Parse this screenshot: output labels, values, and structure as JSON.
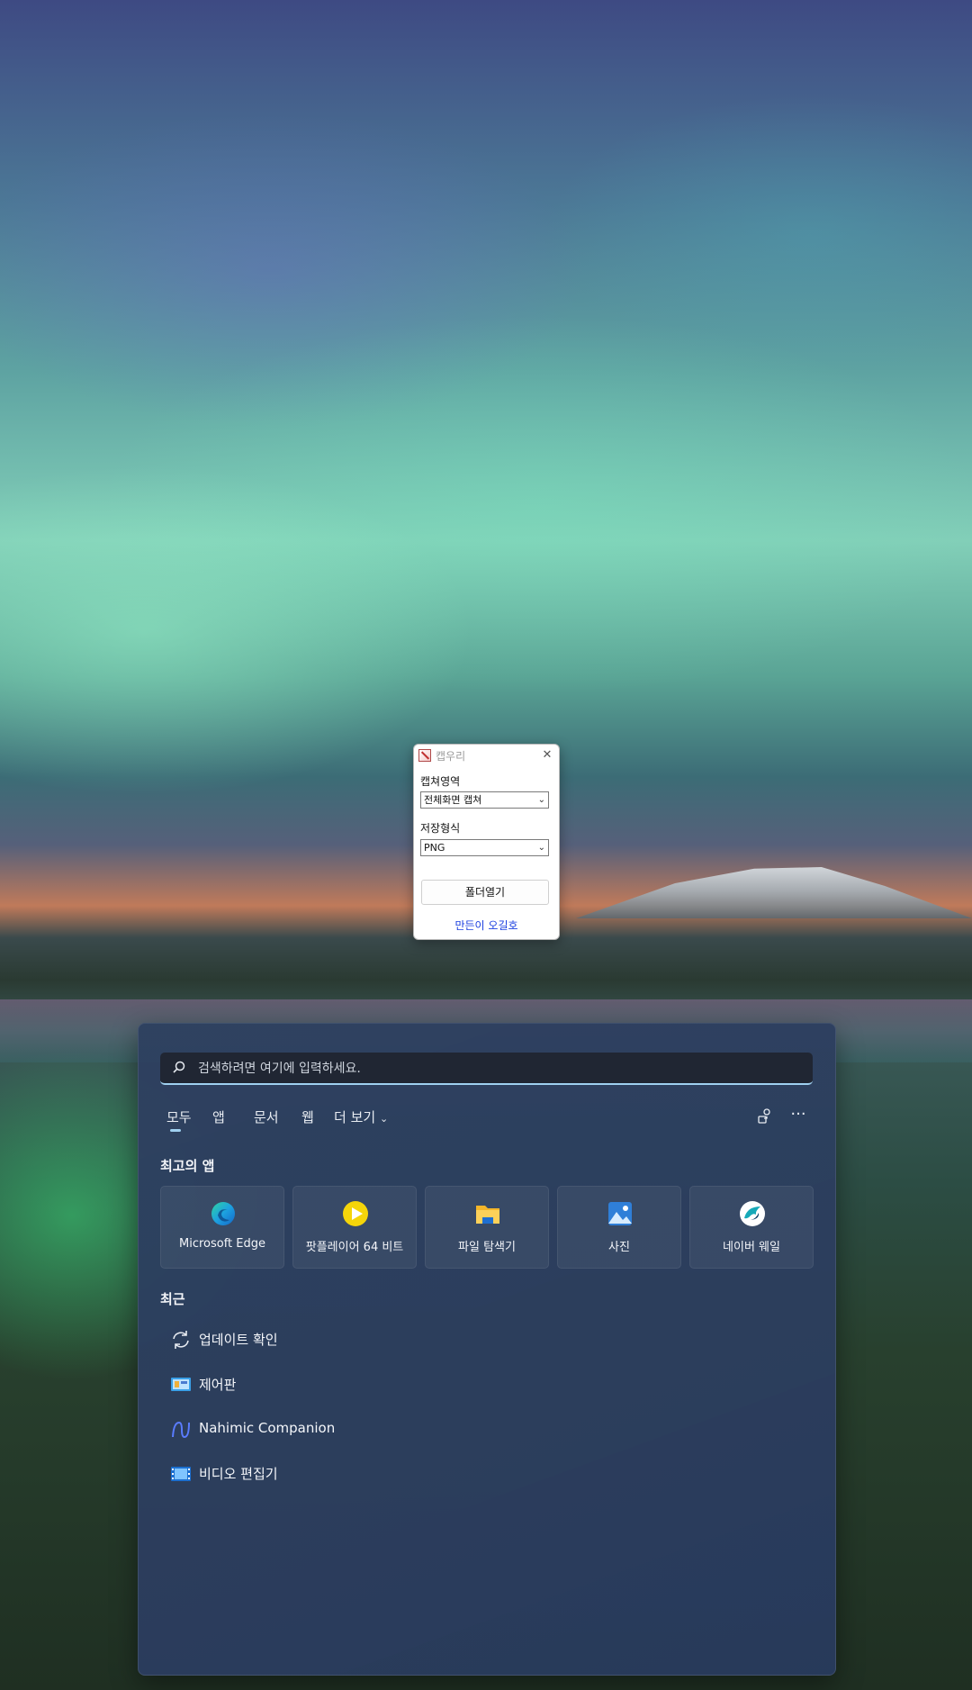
{
  "dialog": {
    "title": "캡우리",
    "capture_area_label": "캡쳐영역",
    "capture_area_value": "전체화면 캡쳐",
    "save_format_label": "저장형식",
    "save_format_value": "PNG",
    "open_folder_button": "폴더열기",
    "author_link": "만든이 오길호"
  },
  "start_menu": {
    "search_placeholder": "검색하려면 여기에 입력하세요.",
    "tabs": [
      "모두",
      "앱",
      "문서",
      "웹",
      "더 보기"
    ],
    "active_tab": "모두",
    "top_apps_title": "최고의 앱",
    "top_apps": [
      {
        "label": "Microsoft Edge",
        "icon": "edge-icon"
      },
      {
        "label": "팟플레이어 64 비트",
        "icon": "potplayer-icon"
      },
      {
        "label": "파일 탐색기",
        "icon": "folder-icon"
      },
      {
        "label": "사진",
        "icon": "photos-icon"
      },
      {
        "label": "네이버 웨일",
        "icon": "whale-icon"
      }
    ],
    "recent_title": "최근",
    "recent": [
      {
        "label": "업데이트 확인",
        "icon": "refresh-icon"
      },
      {
        "label": "제어판",
        "icon": "control-panel-icon"
      },
      {
        "label": "Nahimic Companion",
        "icon": "nahimic-icon"
      },
      {
        "label": "비디오 편집기",
        "icon": "video-editor-icon"
      }
    ]
  },
  "colors": {
    "accent": "#9fd0f0",
    "link": "#1a3ee0",
    "panel": "#2e4060"
  }
}
